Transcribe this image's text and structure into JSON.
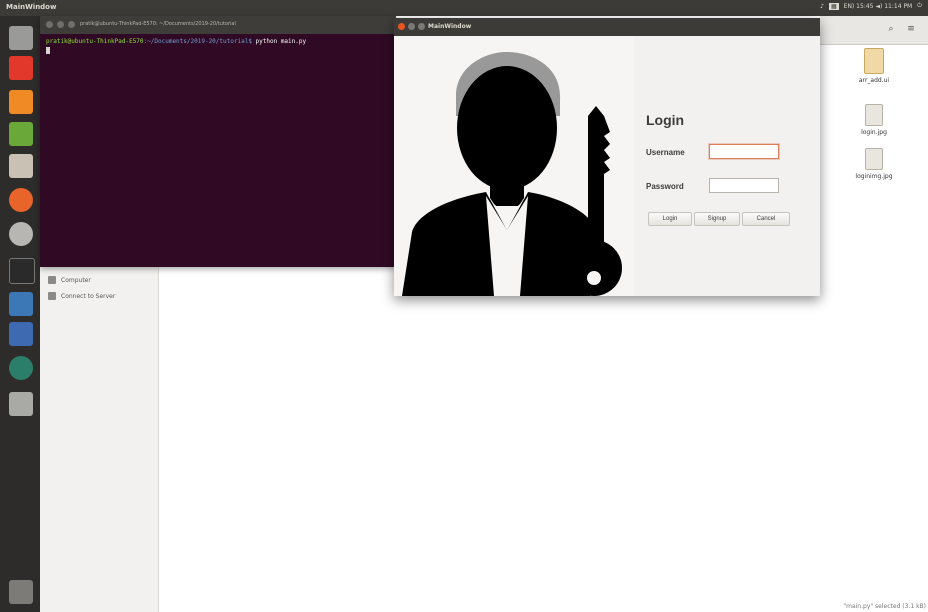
{
  "topbar": {
    "title": "MainWindow",
    "tray_text": "EN) 15:45 ◄) 11:14 PM",
    "icons": [
      "sound-icon",
      "keyboard-icon",
      "network-icon",
      "volume-icon",
      "power-icon"
    ]
  },
  "launcher": {
    "items": [
      "ubuntu-dash-icon",
      "ubuntu-software-icon",
      "sublime-text-icon",
      "gedit-icon",
      "files-icon",
      "firefox-icon",
      "settings-icon",
      "terminal-icon",
      "python-icon",
      "ide-icon",
      "earth-icon",
      "disk-icon",
      "trash-icon"
    ]
  },
  "terminal": {
    "title": "pratik@ubuntu-ThinkPad-E570: ~/Documents/2019-20/tutorial",
    "prompt_user": "pratik@ubuntu-ThinkPad-E570",
    "prompt_path": ":~/Documents/2019-20/tutorial$",
    "command": " python main.py"
  },
  "file_manager": {
    "sidebar": [
      {
        "label": "Computer",
        "icon": "computer-icon"
      },
      {
        "label": "Connect to Server",
        "icon": "server-icon"
      }
    ],
    "files": [
      {
        "name": "arr_add.ui",
        "icon": "ui-file-icon"
      },
      {
        "name": "login.jpg",
        "icon": "image-file-icon"
      },
      {
        "name": "loginimg.jpg",
        "icon": "image-file-icon"
      }
    ],
    "status": "\"main.py\" selected (3.1 kB)"
  },
  "login_window": {
    "title": "MainWindow",
    "heading": "Login",
    "username_label": "Username",
    "password_label": "Password",
    "username_value": "",
    "password_value": "",
    "buttons": {
      "login": "Login",
      "signup": "Signup",
      "cancel": "Cancel"
    }
  },
  "colors": {
    "terminal_bg": "#300a24",
    "titlebar": "#3c3b37",
    "close_button": "#e95420"
  }
}
